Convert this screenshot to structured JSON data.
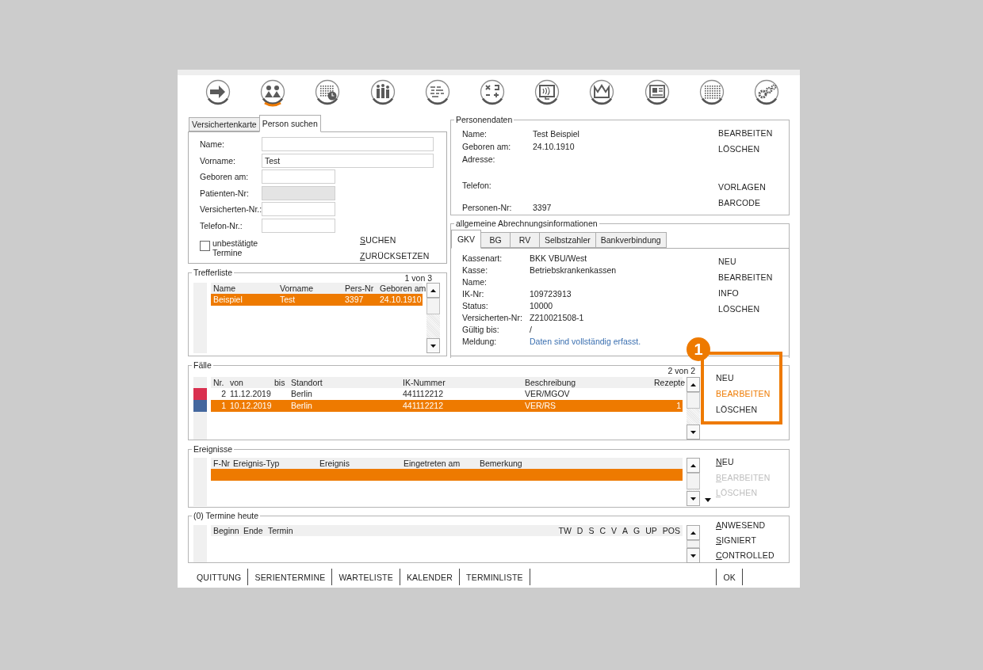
{
  "toolbar": [
    {
      "kind": "arrow",
      "selected": false
    },
    {
      "kind": "people",
      "selected": true
    },
    {
      "kind": "calendar",
      "selected": false
    },
    {
      "kind": "bars",
      "selected": false
    },
    {
      "kind": "lines",
      "selected": false
    },
    {
      "kind": "calc",
      "selected": false
    },
    {
      "kind": "monitor",
      "selected": false
    },
    {
      "kind": "crown",
      "selected": false
    },
    {
      "kind": "idcard",
      "selected": false
    },
    {
      "kind": "grid",
      "selected": false
    },
    {
      "kind": "gears",
      "selected": false
    }
  ],
  "search_tabs": [
    {
      "label": "Versichertenkarte",
      "selected": false
    },
    {
      "label": "Person suchen",
      "selected": true
    }
  ],
  "search_form": {
    "fields": [
      {
        "label": "Name:",
        "kind": "long",
        "disabled": false
      },
      {
        "label": "Vorname:",
        "value": "Test",
        "kind": "long",
        "disabled": false
      },
      {
        "label": "Geboren am:",
        "kind": "short",
        "disabled": false
      },
      {
        "label": "Patienten-Nr:",
        "kind": "short",
        "disabled": true
      },
      {
        "label": "Versicherten-Nr.:",
        "kind": "short",
        "disabled": false
      },
      {
        "label": "Telefon-Nr.:",
        "kind": "short",
        "disabled": false
      }
    ],
    "checkbox": {
      "label": "unbestätigte Termine",
      "checked": false
    },
    "buttons": [
      {
        "label": "SUCHEN",
        "mnemonic": true,
        "disabled": false,
        "highlighted": false
      },
      {
        "label": "ZURÜCKSETZEN",
        "mnemonic": true,
        "disabled": false,
        "highlighted": false
      }
    ]
  },
  "results": {
    "title": "Trefferliste",
    "count": "1 von 3",
    "columns": [
      "Name",
      "Vorname",
      "Pers-Nr",
      "Geboren am"
    ],
    "rows": [
      {
        "cells": [
          "Beispiel",
          "Test",
          "3397",
          "24.10.1910"
        ],
        "selected": true
      }
    ]
  },
  "person": {
    "title": "Personendaten",
    "fields": [
      {
        "label": "Name:",
        "value": "Test Beispiel"
      },
      {
        "label": "Geboren am:",
        "value": "24.10.1910"
      },
      {
        "label": "Adresse:"
      },
      {
        "label": "Telefon:"
      },
      {
        "label": "Personen-Nr:",
        "value": "3397"
      }
    ],
    "buttons": [
      {
        "label": "BEARBEITEN",
        "mnemonic": false,
        "disabled": false,
        "highlighted": false
      },
      {
        "label": "LÖSCHEN",
        "mnemonic": false,
        "disabled": false,
        "highlighted": false
      },
      {
        "label": "VORLAGEN",
        "mnemonic": false,
        "disabled": false,
        "highlighted": false
      },
      {
        "label": "BARCODE",
        "mnemonic": false,
        "disabled": false,
        "highlighted": false
      }
    ]
  },
  "billing": {
    "title": "allgemeine Abrechnungsinformationen",
    "tabs": [
      {
        "label": "GKV",
        "selected": true
      },
      {
        "label": "BG",
        "selected": false
      },
      {
        "label": "RV",
        "selected": false
      },
      {
        "label": "Selbstzahler",
        "selected": false
      },
      {
        "label": "Bankverbindung",
        "selected": false
      }
    ],
    "fields": [
      {
        "label": "Kassenart:",
        "value": "BKK VBU/West",
        "kind": "plain"
      },
      {
        "label": "Kasse:",
        "value": "Betriebskrankenkassen",
        "kind": "plain"
      },
      {
        "label": "Name:"
      },
      {
        "label": "IK-Nr:",
        "value": "109723913",
        "kind": "plain"
      },
      {
        "label": "Status:",
        "value": "10000",
        "kind": "plain"
      },
      {
        "label": "Versicherten-Nr:",
        "value": "Z210021508-1",
        "kind": "plain"
      },
      {
        "label": "Gültig bis:",
        "value": "/",
        "kind": "plain"
      },
      {
        "label": "Meldung:",
        "value": "Daten sind vollständig erfasst.",
        "kind": "message"
      }
    ],
    "buttons": [
      {
        "label": "NEU",
        "mnemonic": false,
        "disabled": false,
        "highlighted": false
      },
      {
        "label": "BEARBEITEN",
        "mnemonic": false,
        "disabled": false,
        "highlighted": false
      },
      {
        "label": "INFO",
        "mnemonic": false,
        "disabled": false,
        "highlighted": false
      },
      {
        "label": "LÖSCHEN",
        "mnemonic": false,
        "disabled": false,
        "highlighted": false
      }
    ]
  },
  "cases": {
    "title": "Fälle",
    "count": "2 von 2",
    "columns": [
      "Nr.",
      "von",
      "bis",
      "Standort",
      "IK-Nummer",
      "Beschreibung",
      "Rezepte"
    ],
    "rows": [
      {
        "color": "#d9304f",
        "selected": false,
        "cells": {
          "nr": "2",
          "von": "11.12.2019",
          "standort": "Berlin",
          "ik": "441112212",
          "beschreibung": "VER/MGOV"
        }
      },
      {
        "color": "#44679e",
        "selected": true,
        "cells": {
          "nr": "1",
          "von": "10.12.2019",
          "standort": "Berlin",
          "ik": "441112212",
          "beschreibung": "VER/RS",
          "rezepte": "1"
        }
      }
    ],
    "buttons": [
      {
        "label": "NEU",
        "mnemonic": false,
        "disabled": false,
        "highlighted": false
      },
      {
        "label": "BEARBEITEN",
        "mnemonic": false,
        "disabled": false,
        "highlighted": true
      },
      {
        "label": "LÖSCHEN",
        "mnemonic": false,
        "disabled": false,
        "highlighted": false
      }
    ]
  },
  "events": {
    "title": "Ereignisse",
    "columns": [
      "F-Nr",
      "Ereignis-Typ",
      "Ereignis",
      "Eingetreten am",
      "Bemerkung"
    ],
    "rows": [
      {
        "selected": true
      }
    ],
    "buttons": [
      {
        "label": "NEU",
        "mnemonic": true,
        "disabled": false,
        "highlighted": false
      },
      {
        "label": "BEARBEITEN",
        "mnemonic": true,
        "disabled": true,
        "highlighted": false
      },
      {
        "label": "LÖSCHEN",
        "mnemonic": true,
        "disabled": true,
        "highlighted": false
      }
    ]
  },
  "appointments": {
    "title": "(0) Termine heute",
    "columns": [
      "Beginn",
      "Ende",
      "Termin"
    ],
    "flag_columns": [
      "TW",
      "D",
      "S",
      "C",
      "V",
      "A",
      "G",
      "UP",
      "POS"
    ],
    "buttons": [
      {
        "label": "ANWESEND",
        "mnemonic": true,
        "disabled": false,
        "highlighted": false
      },
      {
        "label": "SIGNIERT",
        "mnemonic": true,
        "disabled": false,
        "highlighted": false
      },
      {
        "label": "CONTROLLED",
        "mnemonic": true,
        "disabled": false,
        "highlighted": false
      }
    ]
  },
  "footer": {
    "buttons": [
      "QUITTUNG",
      "SERIENTERMINE",
      "WARTELISTE",
      "KALENDER",
      "TERMINLISTE"
    ],
    "confirm": "OK"
  },
  "callout": {
    "number": "1"
  }
}
